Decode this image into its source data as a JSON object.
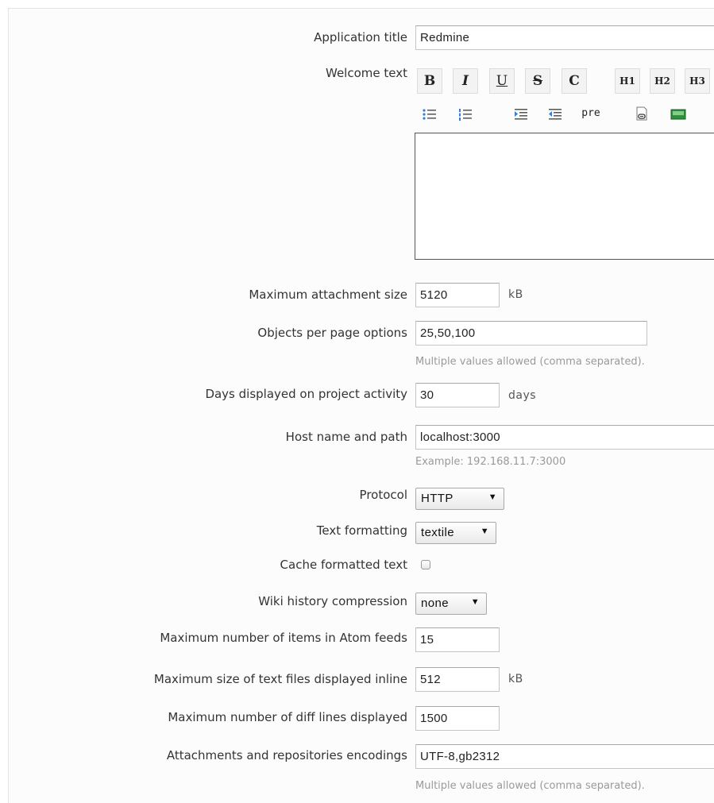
{
  "settings": {
    "app_title": {
      "label": "Application title",
      "value": "Redmine"
    },
    "welcome_text": {
      "label": "Welcome text",
      "toolbar": {
        "bold": "B",
        "italic": "I",
        "underline": "U",
        "strike": "S",
        "code": "C",
        "h1": "H1",
        "h2": "H2",
        "h3": "H3",
        "pre": "pre"
      },
      "value": ""
    },
    "max_attachment_size": {
      "label": "Maximum attachment size",
      "value": "5120",
      "unit": "kB"
    },
    "per_page_options": {
      "label": "Objects per page options",
      "value": "25,50,100",
      "hint": "Multiple values allowed (comma separated)."
    },
    "activity_days": {
      "label": "Days displayed on project activity",
      "value": "30",
      "unit": "days"
    },
    "host_name": {
      "label": "Host name and path",
      "value": "localhost:3000",
      "hint": "Example: 192.168.11.7:3000"
    },
    "protocol": {
      "label": "Protocol",
      "value": "HTTP"
    },
    "text_formatting": {
      "label": "Text formatting",
      "value": "textile"
    },
    "cache_formatted_text": {
      "label": "Cache formatted text",
      "checked": false
    },
    "wiki_compression": {
      "label": "Wiki history compression",
      "value": "none"
    },
    "feeds_limit": {
      "label": "Maximum number of items in Atom feeds",
      "value": "15"
    },
    "max_inline_size": {
      "label": "Maximum size of text files displayed inline",
      "value": "512",
      "unit": "kB"
    },
    "diff_max_lines": {
      "label": "Maximum number of diff lines displayed",
      "value": "1500"
    },
    "repo_encodings": {
      "label": "Attachments and repositories encodings",
      "value": "UTF-8,gb2312",
      "hint": "Multiple values allowed (comma separated)."
    }
  }
}
